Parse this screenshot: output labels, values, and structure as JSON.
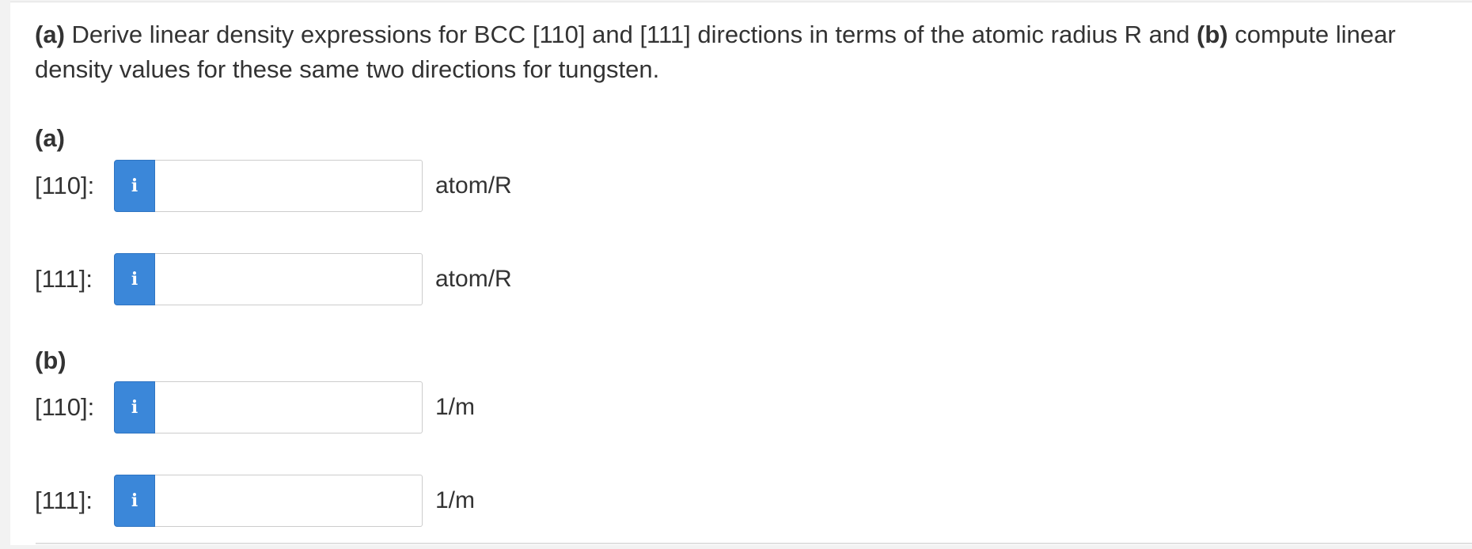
{
  "question": {
    "part_a_marker": "(a)",
    "text_1": " Derive linear density expressions for BCC [110] and [111] directions in terms of the atomic radius R and ",
    "part_b_marker": "(b)",
    "text_2": " compute linear density values for these same two directions for tungsten."
  },
  "part_a": {
    "label": "(a)",
    "rows": [
      {
        "label": "[110]:",
        "icon": "info-icon",
        "info_glyph": "i",
        "value": "",
        "unit": "atom/R"
      },
      {
        "label": "[111]:",
        "icon": "info-icon",
        "info_glyph": "i",
        "value": "",
        "unit": "atom/R"
      }
    ]
  },
  "part_b": {
    "label": "(b)",
    "rows": [
      {
        "label": "[110]:",
        "icon": "info-icon",
        "info_glyph": "i",
        "value": "",
        "unit": "1/m"
      },
      {
        "label": "[111]:",
        "icon": "info-icon",
        "info_glyph": "i",
        "value": "",
        "unit": "1/m"
      }
    ]
  },
  "colors": {
    "info_button": "#3b87d9",
    "text": "#333333",
    "input_border": "#cccccc"
  }
}
